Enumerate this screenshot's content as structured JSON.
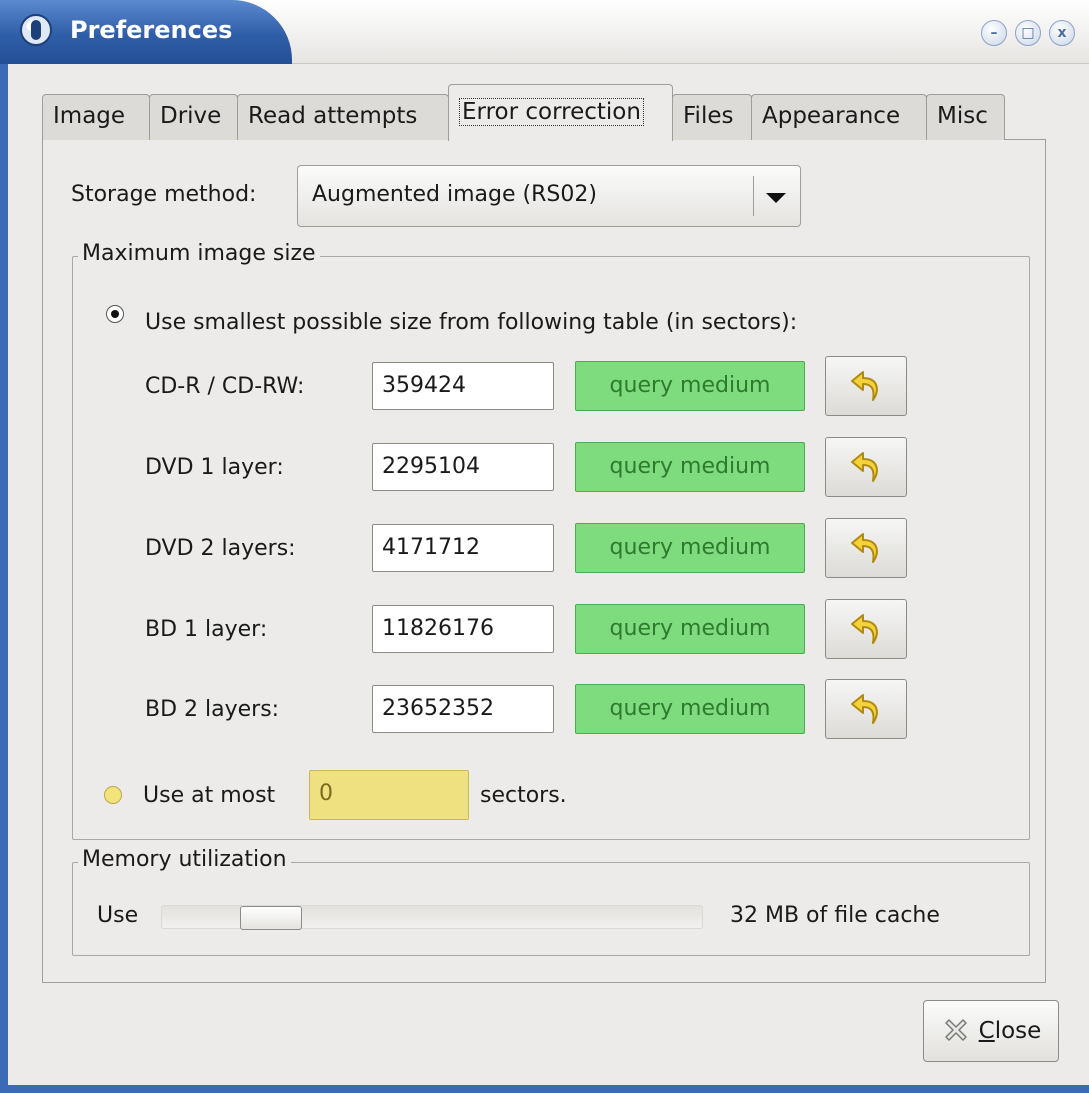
{
  "window": {
    "title": "Preferences",
    "wm_minimize": "–",
    "wm_maximize": "□",
    "wm_close": "x"
  },
  "tabs": [
    {
      "label": "Image"
    },
    {
      "label": "Drive"
    },
    {
      "label": "Read attempts"
    },
    {
      "label": "Error correction",
      "active": true
    },
    {
      "label": "Files"
    },
    {
      "label": "Appearance"
    },
    {
      "label": "Misc"
    }
  ],
  "storage": {
    "label": "Storage method:",
    "value": "Augmented image (RS02)"
  },
  "max_size": {
    "frame_title": "Maximum image size",
    "table_option_label": "Use smallest possible size from following table (in sectors):",
    "table_option_selected": true,
    "rows": [
      {
        "label": "CD-R / CD-RW:",
        "value": "359424",
        "query_label": "query medium"
      },
      {
        "label": "DVD 1 layer:",
        "value": "2295104",
        "query_label": "query medium"
      },
      {
        "label": "DVD 2 layers:",
        "value": "4171712",
        "query_label": "query medium"
      },
      {
        "label": "BD 1 layer:",
        "value": "11826176",
        "query_label": "query medium"
      },
      {
        "label": "BD 2 layers:",
        "value": "23652352",
        "query_label": "query medium"
      }
    ],
    "atmost_prefix": "Use at most",
    "atmost_value": "0",
    "atmost_suffix": "sectors.",
    "atmost_selected": false
  },
  "memory": {
    "frame_title": "Memory utilization",
    "use_label": "Use",
    "cache_label": "32 MB of file cache",
    "slider_fraction": 0.08
  },
  "close_button": {
    "mnemonic": "C",
    "rest": "lose"
  },
  "colors": {
    "query_green": "#7edb7e",
    "title_blue": "#2f5ea8",
    "entry_yellow": "#efe080"
  }
}
